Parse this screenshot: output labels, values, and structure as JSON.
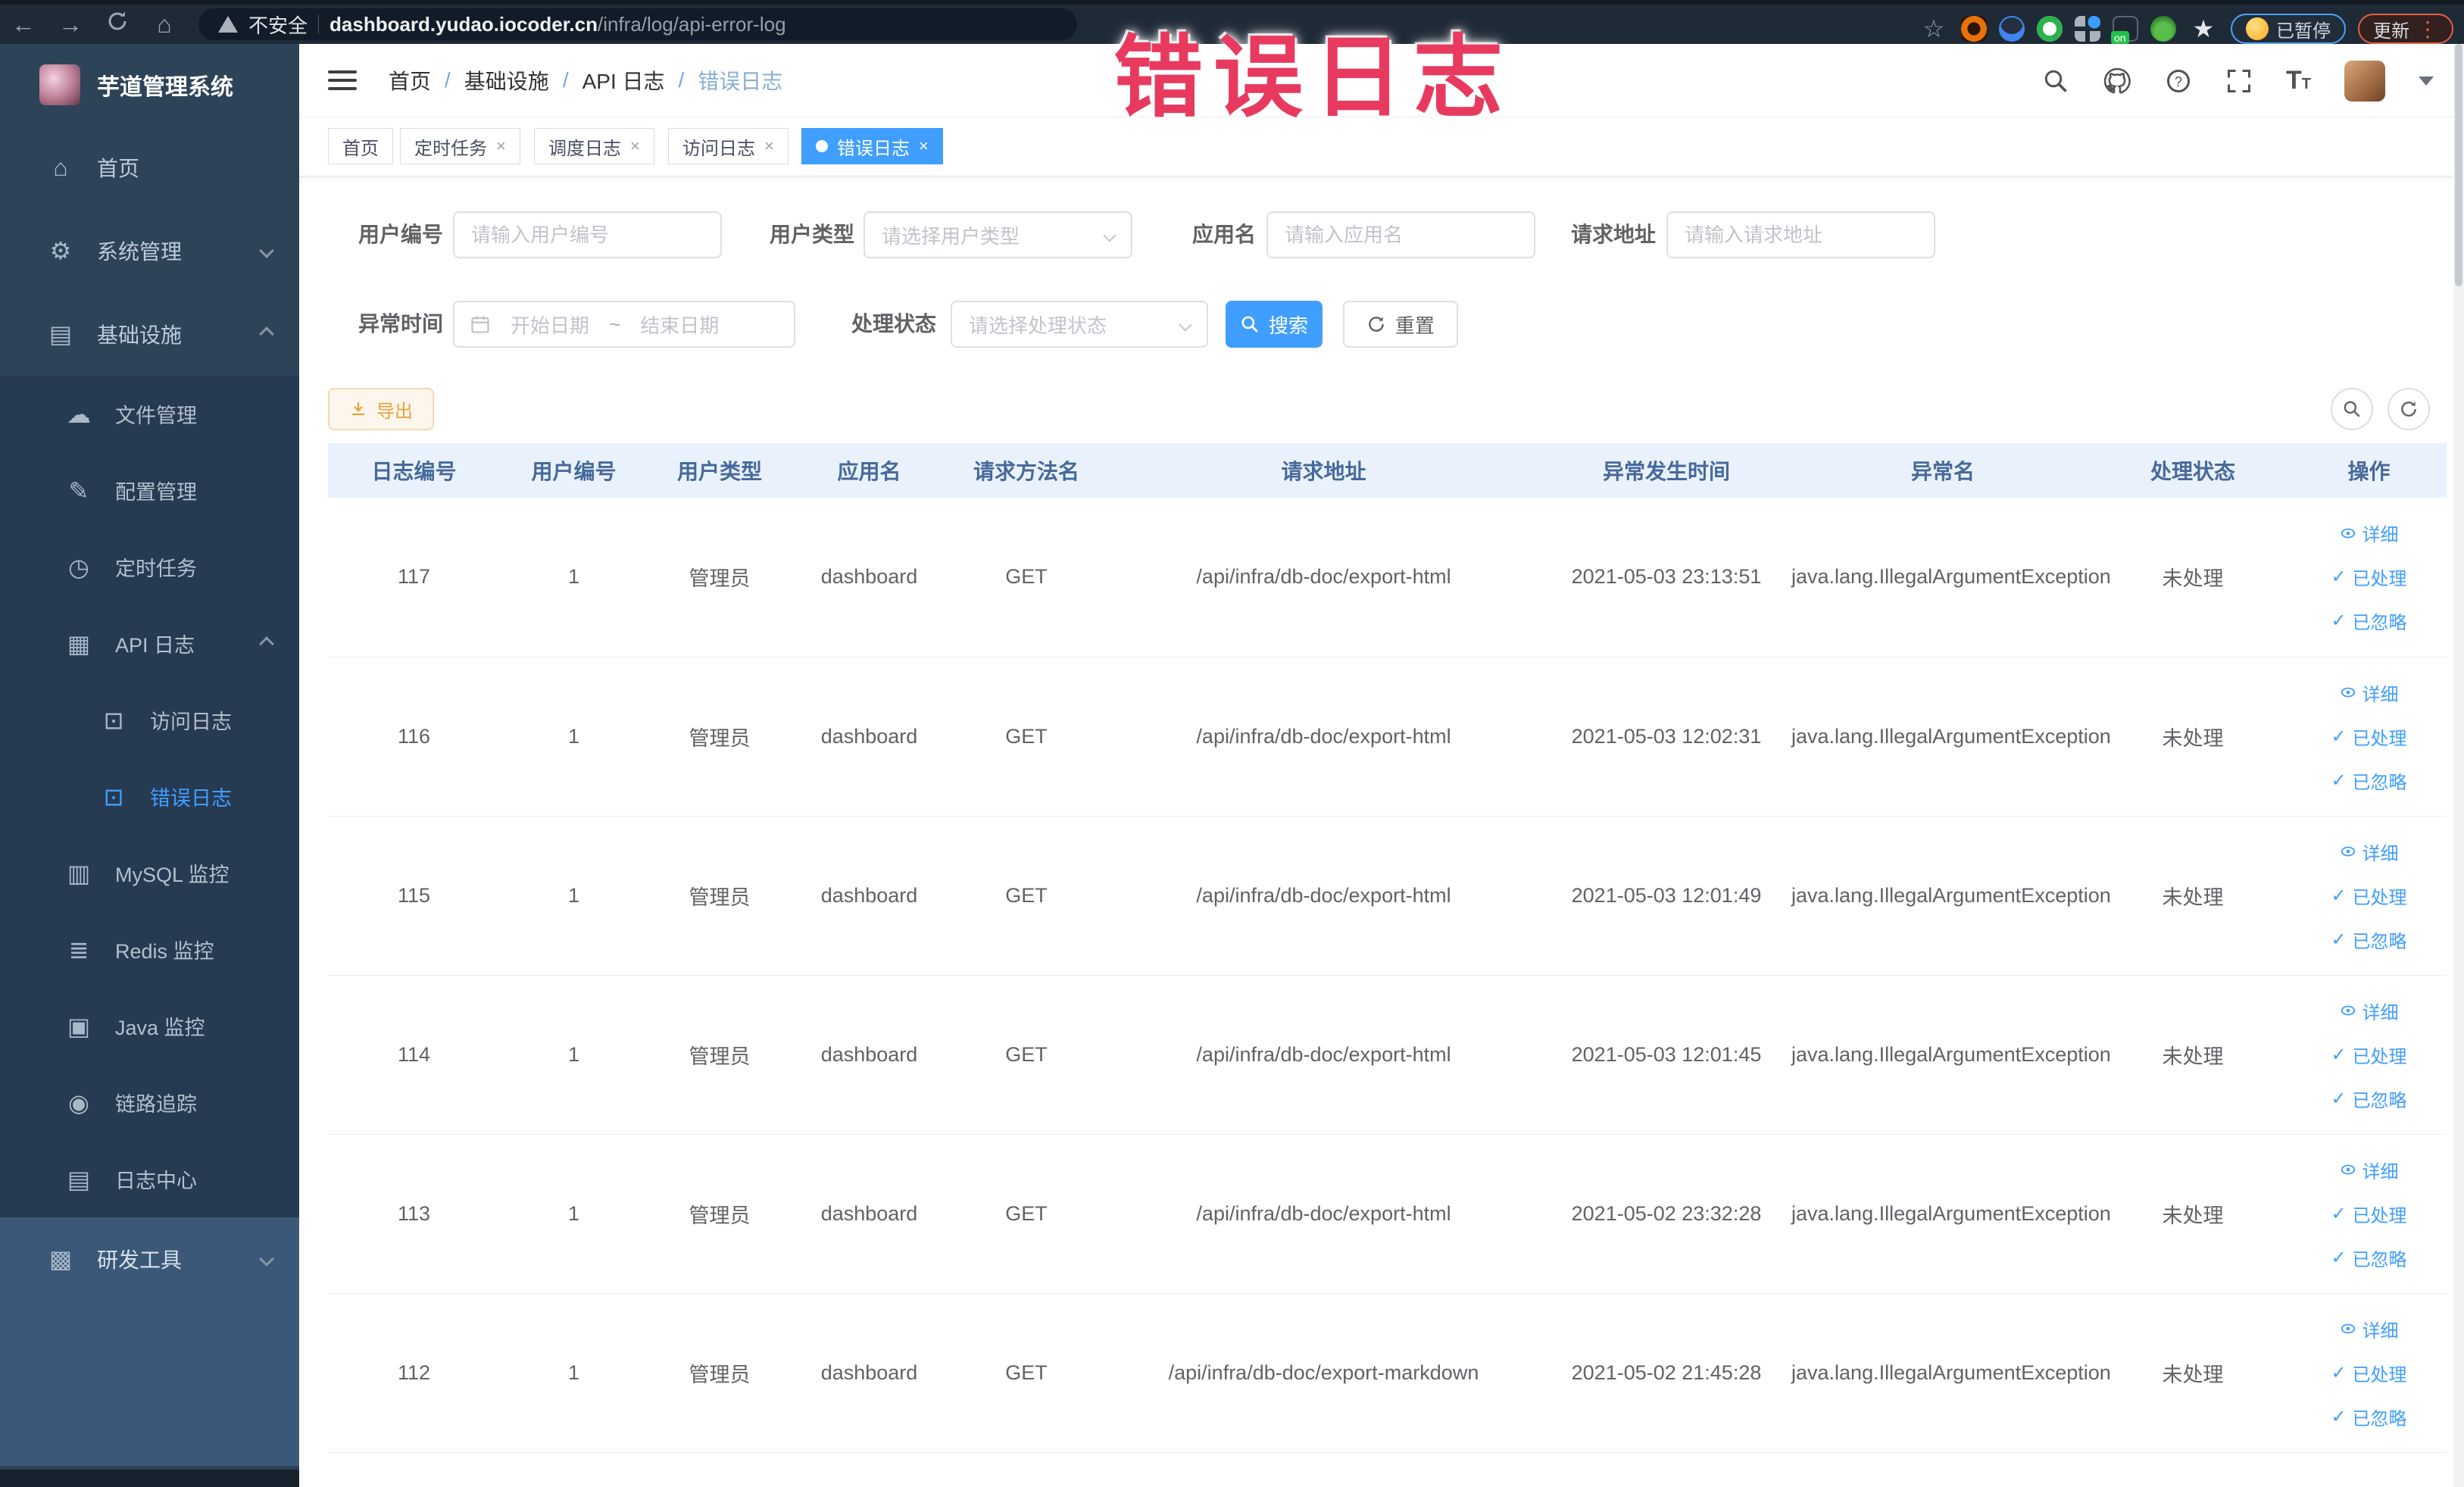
{
  "watermark": {
    "text": "错误日志"
  },
  "browser": {
    "security_label": "不安全",
    "url_domain": "dashboard.yudao.iocoder.cn",
    "url_path": "/infra/log/api-error-log",
    "paused_label": "已暂停",
    "update_label": "更新"
  },
  "sidebar": {
    "title": "芋道管理系统",
    "items": [
      "首页",
      "系统管理",
      "基础设施",
      "文件管理",
      "配置管理",
      "定时任务",
      "API 日志",
      "访问日志",
      "错误日志",
      "MySQL 监控",
      "Redis 监控",
      "Java 监控",
      "链路追踪",
      "日志中心",
      "研发工具"
    ]
  },
  "header": {
    "breadcrumb": [
      "首页",
      "基础设施",
      "API 日志",
      "错误日志"
    ],
    "separator": "/"
  },
  "tabs": [
    {
      "label": "首页"
    },
    {
      "label": "定时任务"
    },
    {
      "label": "调度日志"
    },
    {
      "label": "访问日志"
    },
    {
      "label": "错误日志"
    }
  ],
  "filters": {
    "user_id": {
      "label": "用户编号",
      "placeholder": "请输入用户编号"
    },
    "user_type": {
      "label": "用户类型",
      "placeholder": "请选择用户类型"
    },
    "app_name": {
      "label": "应用名",
      "placeholder": "请输入应用名"
    },
    "request_url": {
      "label": "请求地址",
      "placeholder": "请输入请求地址"
    },
    "exception_time": {
      "label": "异常时间",
      "start_placeholder": "开始日期",
      "separator": "~",
      "end_placeholder": "结束日期"
    },
    "process_status": {
      "label": "处理状态",
      "placeholder": "请选择处理状态"
    },
    "search_label": "搜索",
    "reset_label": "重置"
  },
  "toolbar": {
    "export_label": "导出"
  },
  "table": {
    "headers": [
      "日志编号",
      "用户编号",
      "用户类型",
      "应用名",
      "请求方法名",
      "请求地址",
      "异常发生时间",
      "异常名",
      "处理状态",
      "操作"
    ],
    "actions": [
      "详细",
      "已处理",
      "已忽略"
    ],
    "rows": [
      {
        "id": "117",
        "user_id": "1",
        "user_type": "管理员",
        "app": "dashboard",
        "method": "GET",
        "url": "/api/infra/db-doc/export-html",
        "time": "2021-05-03 23:13:51",
        "exception": "java.lang.IllegalArgumentException",
        "status": "未处理"
      },
      {
        "id": "116",
        "user_id": "1",
        "user_type": "管理员",
        "app": "dashboard",
        "method": "GET",
        "url": "/api/infra/db-doc/export-html",
        "time": "2021-05-03 12:02:31",
        "exception": "java.lang.IllegalArgumentException",
        "status": "未处理"
      },
      {
        "id": "115",
        "user_id": "1",
        "user_type": "管理员",
        "app": "dashboard",
        "method": "GET",
        "url": "/api/infra/db-doc/export-html",
        "time": "2021-05-03 12:01:49",
        "exception": "java.lang.IllegalArgumentException",
        "status": "未处理"
      },
      {
        "id": "114",
        "user_id": "1",
        "user_type": "管理员",
        "app": "dashboard",
        "method": "GET",
        "url": "/api/infra/db-doc/export-html",
        "time": "2021-05-03 12:01:45",
        "exception": "java.lang.IllegalArgumentException",
        "status": "未处理"
      },
      {
        "id": "113",
        "user_id": "1",
        "user_type": "管理员",
        "app": "dashboard",
        "method": "GET",
        "url": "/api/infra/db-doc/export-html",
        "time": "2021-05-02 23:32:28",
        "exception": "java.lang.IllegalArgumentException",
        "status": "未处理"
      },
      {
        "id": "112",
        "user_id": "1",
        "user_type": "管理员",
        "app": "dashboard",
        "method": "GET",
        "url": "/api/infra/db-doc/export-markdown",
        "time": "2021-05-02 21:45:28",
        "exception": "java.lang.IllegalArgumentException",
        "status": "未处理"
      }
    ]
  },
  "colors": {
    "accent": "#409eff",
    "warning": "#e6a23c",
    "watermark": "#e83a5f",
    "sidebar_bg": "#2d4358",
    "table_header_bg": "#e9f2fc"
  }
}
